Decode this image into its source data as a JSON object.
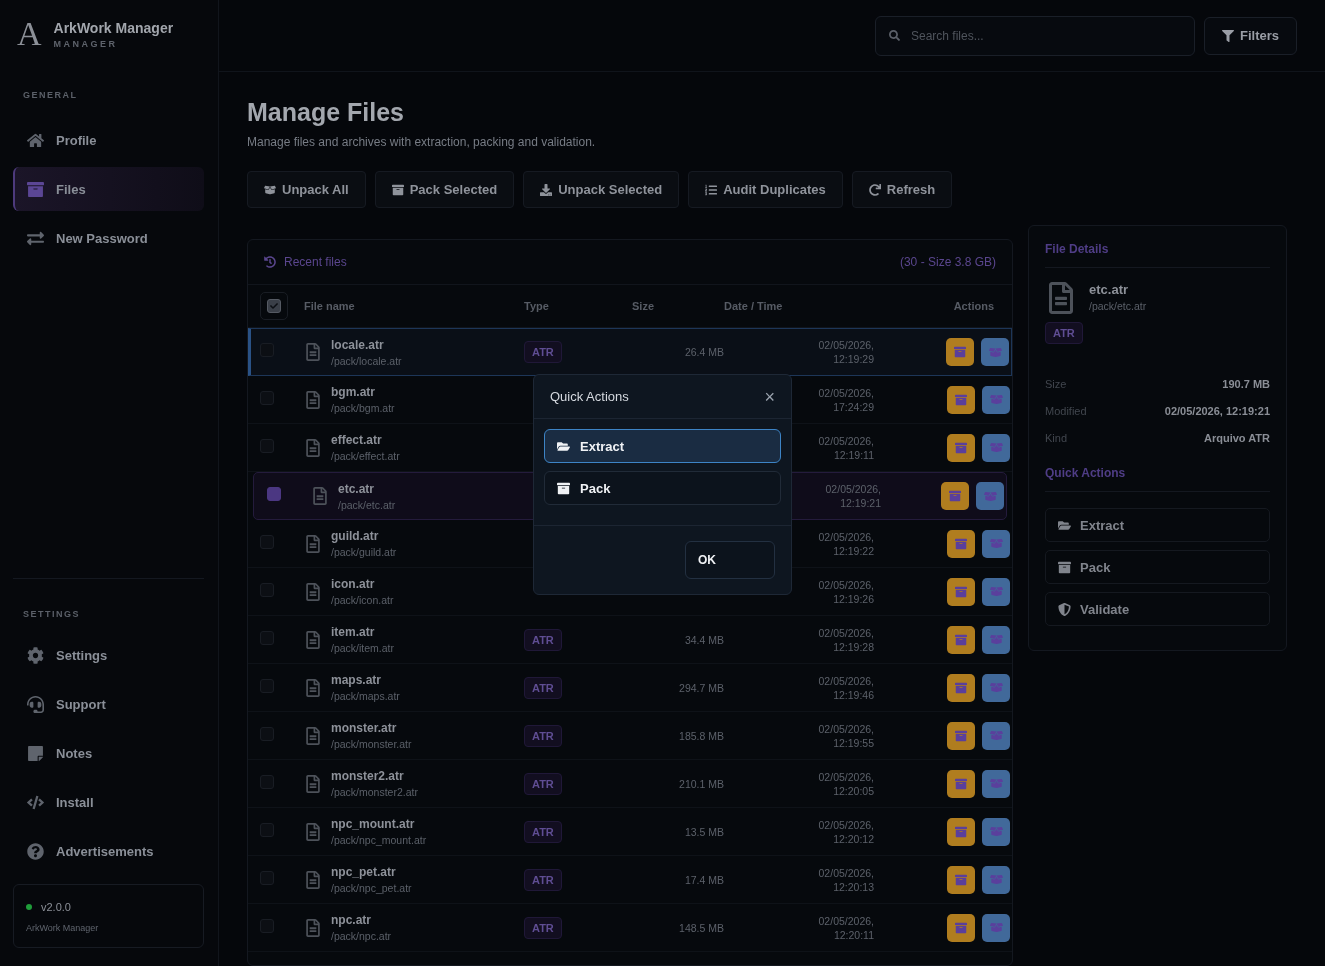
{
  "brand": {
    "logo": "A",
    "name": "ArkWork Manager",
    "sub": "MANAGER"
  },
  "sidebar": {
    "sections": [
      {
        "title": "GENERAL",
        "items": [
          {
            "label": "Profile",
            "selected": false
          },
          {
            "label": "Files",
            "selected": true
          },
          {
            "label": "New Password",
            "selected": false
          }
        ]
      },
      {
        "title": "SETTINGS",
        "items": [
          {
            "label": "Settings",
            "selected": false
          },
          {
            "label": "Support",
            "selected": false
          },
          {
            "label": "Notes",
            "selected": false
          },
          {
            "label": "Install",
            "selected": false
          },
          {
            "label": "Advertisements",
            "selected": false
          }
        ]
      }
    ],
    "version": {
      "label": "v2.0.0",
      "name": "ArkWork Manager",
      "color": "#1f9d3a"
    }
  },
  "search": {
    "placeholder": "Search files..."
  },
  "filters_button": "Filters",
  "page": {
    "title": "Manage Files",
    "subtitle": "Manage files and archives with extraction, packing and validation."
  },
  "toolbar": [
    "Unpack All",
    "Pack Selected",
    "Unpack Selected",
    "Audit Duplicates",
    "Refresh"
  ],
  "table": {
    "title": "Recent files",
    "summary": "(30 - Size 3.8 GB)",
    "all_checked": true,
    "columns": [
      "File name",
      "Type",
      "Size",
      "Date / Time",
      "Actions"
    ],
    "rows": [
      {
        "name": "locale.atr",
        "path": "/pack/locale.atr",
        "type": "ATR",
        "size": "26.4 MB",
        "date": "02/05/2026,",
        "time": "12:19:29",
        "checked": false,
        "focused": true
      },
      {
        "name": "bgm.atr",
        "path": "/pack/bgm.atr",
        "date": "02/05/2026,",
        "time": "17:24:29",
        "checked": false,
        "focused": false
      },
      {
        "name": "effect.atr",
        "path": "/pack/effect.atr",
        "date": "02/05/2026,",
        "time": "12:19:11",
        "checked": false,
        "focused": false
      },
      {
        "name": "etc.atr",
        "path": "/pack/etc.atr",
        "date": "02/05/2026,",
        "time": "12:19:21",
        "checked": true,
        "focused": false
      },
      {
        "name": "guild.atr",
        "path": "/pack/guild.atr",
        "date": "02/05/2026,",
        "time": "12:19:22",
        "checked": false,
        "focused": false
      },
      {
        "name": "icon.atr",
        "path": "/pack/icon.atr",
        "date": "02/05/2026,",
        "time": "12:19:26",
        "checked": false,
        "focused": false
      },
      {
        "name": "item.atr",
        "path": "/pack/item.atr",
        "type": "ATR",
        "size": "34.4 MB",
        "date": "02/05/2026,",
        "time": "12:19:28",
        "checked": false,
        "focused": false
      },
      {
        "name": "maps.atr",
        "path": "/pack/maps.atr",
        "type": "ATR",
        "size": "294.7 MB",
        "date": "02/05/2026,",
        "time": "12:19:46",
        "checked": false,
        "focused": false
      },
      {
        "name": "monster.atr",
        "path": "/pack/monster.atr",
        "type": "ATR",
        "size": "185.8 MB",
        "date": "02/05/2026,",
        "time": "12:19:55",
        "checked": false,
        "focused": false
      },
      {
        "name": "monster2.atr",
        "path": "/pack/monster2.atr",
        "type": "ATR",
        "size": "210.1 MB",
        "date": "02/05/2026,",
        "time": "12:20:05",
        "checked": false,
        "focused": false
      },
      {
        "name": "npc_mount.atr",
        "path": "/pack/npc_mount.atr",
        "type": "ATR",
        "size": "13.5 MB",
        "date": "02/05/2026,",
        "time": "12:20:12",
        "checked": false,
        "focused": false
      },
      {
        "name": "npc_pet.atr",
        "path": "/pack/npc_pet.atr",
        "type": "ATR",
        "size": "17.4 MB",
        "date": "02/05/2026,",
        "time": "12:20:13",
        "checked": false,
        "focused": false
      },
      {
        "name": "npc.atr",
        "path": "/pack/npc.atr",
        "type": "ATR",
        "size": "148.5 MB",
        "date": "02/05/2026,",
        "time": "12:20:11",
        "checked": false,
        "focused": false
      }
    ]
  },
  "details": {
    "title": "File Details",
    "name": "etc.atr",
    "path": "/pack/etc.atr",
    "type": "ATR",
    "props": [
      {
        "label": "Size",
        "value": "190.7 MB"
      },
      {
        "label": "Modified",
        "value": "02/05/2026, 12:19:21"
      },
      {
        "label": "Kind",
        "value": "Arquivo ATR"
      }
    ],
    "actions_title": "Quick Actions",
    "actions": [
      "Extract",
      "Pack",
      "Validate"
    ]
  },
  "modal": {
    "title": "Quick Actions",
    "close": "×",
    "options": [
      {
        "label": "Extract",
        "selected": true
      },
      {
        "label": "Pack",
        "selected": false
      }
    ],
    "ok": "OK"
  }
}
